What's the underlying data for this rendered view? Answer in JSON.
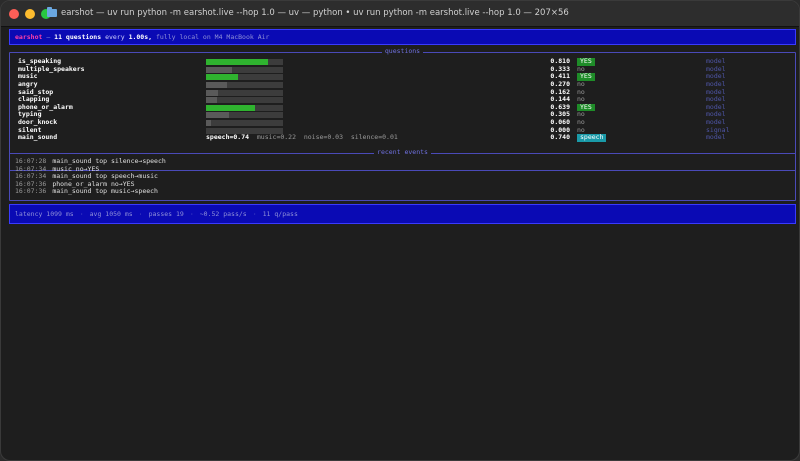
{
  "window": {
    "title": "earshot — uv run python -m earshot.live --hop 1.0 — uv — python • uv run python -m earshot.live --hop 1.0 — 207×56"
  },
  "header": {
    "app": "earshot",
    "dash": "—",
    "count": "11 questions",
    "every": "every",
    "interval": "1.00s,",
    "suffix": "fully local on M4 MacBook Air"
  },
  "questions_panel": {
    "title": "questions",
    "rows": [
      {
        "name": "is_speaking",
        "value": "0.810",
        "fill": 0.81,
        "answer": "YES",
        "answer_kind": "yes",
        "source": "model"
      },
      {
        "name": "multiple_speakers",
        "value": "0.333",
        "fill": 0.333,
        "answer": "no",
        "answer_kind": "no",
        "source": "model"
      },
      {
        "name": "music",
        "value": "0.411",
        "fill": 0.411,
        "answer": "YES",
        "answer_kind": "yes",
        "source": "model"
      },
      {
        "name": "angry",
        "value": "0.270",
        "fill": 0.27,
        "answer": "no",
        "answer_kind": "no",
        "source": "model"
      },
      {
        "name": "said_stop",
        "value": "0.162",
        "fill": 0.162,
        "answer": "no",
        "answer_kind": "no",
        "source": "model"
      },
      {
        "name": "clapping",
        "value": "0.144",
        "fill": 0.144,
        "answer": "no",
        "answer_kind": "no",
        "source": "model"
      },
      {
        "name": "phone_or_alarm",
        "value": "0.639",
        "fill": 0.639,
        "answer": "YES",
        "answer_kind": "yes",
        "source": "model"
      },
      {
        "name": "typing",
        "value": "0.305",
        "fill": 0.305,
        "answer": "no",
        "answer_kind": "no",
        "source": "model"
      },
      {
        "name": "door_knock",
        "value": "0.060",
        "fill": 0.06,
        "answer": "no",
        "answer_kind": "no",
        "source": "model"
      },
      {
        "name": "silent",
        "value": "0.000",
        "fill": 0.0,
        "answer": "no",
        "answer_kind": "no",
        "source": "signal"
      }
    ],
    "main_sound": {
      "name": "main_sound",
      "speech": "speech=0.74",
      "music": "music=0.22",
      "noise": "noise=0.03",
      "silence": "silence=0.01",
      "value": "0.740",
      "answer": "speech",
      "source": "model"
    }
  },
  "events_panel": {
    "title": "recent events",
    "rows": [
      {
        "time": "16:07:28",
        "text": "main_sound top silence→speech"
      },
      {
        "time": "16:07:34",
        "text": "music no→YES"
      },
      {
        "time": "16:07:34",
        "text": "main_sound top speech→music"
      },
      {
        "time": "16:07:36",
        "text": "phone_or_alarm no→YES"
      },
      {
        "time": "16:07:36",
        "text": "main_sound top music→speech"
      }
    ]
  },
  "footer": {
    "latency": "latency 1099 ms",
    "avg": "avg 1050 ms",
    "passes": "passes 19",
    "rate": "~0.52 pass/s",
    "qpass": "11 q/pass",
    "sep": "·"
  },
  "colors": {
    "bar_yes": "#2fb32f",
    "bar_no": "#5a5a5a",
    "header_bg": "#0a0ab4"
  }
}
